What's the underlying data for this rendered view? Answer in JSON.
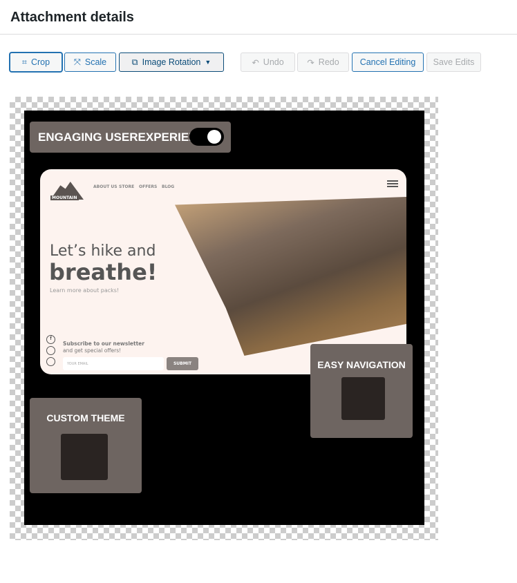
{
  "header": {
    "title": "Attachment details"
  },
  "toolbar": {
    "crop": "Crop",
    "scale": "Scale",
    "rotation": "Image Rotation",
    "undo": "Undo",
    "redo": "Redo",
    "cancel": "Cancel Editing",
    "save": "Save Edits"
  },
  "image": {
    "badge_top": "ENGAGING USEREXPERIENCE",
    "badge_nav": "EASY NAVIGATION",
    "badge_theme": "CUSTOM THEME",
    "site": {
      "logo": "MOUNTAIN",
      "nav": [
        "ABOUT US",
        "STORE",
        "OFFERS",
        "BLOG"
      ],
      "headline1": "Let’s hike and",
      "headline2": "breathe!",
      "sub": "Learn more about packs!",
      "newsletter1": "Subscribe to our newsletter",
      "newsletter2": "and get special offers!",
      "email_placeholder": "YOUR EMAIL",
      "submit": "SUBMIT"
    }
  }
}
